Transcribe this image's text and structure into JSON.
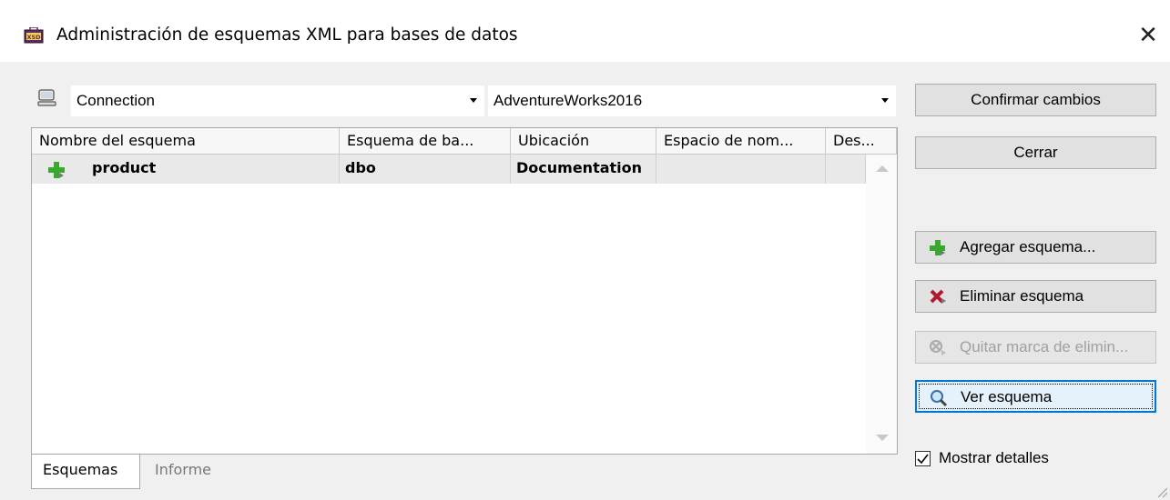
{
  "window": {
    "title": "Administración de esquemas XML para bases de datos",
    "close_glyph": "✕",
    "icon_text": "XSD"
  },
  "connection": {
    "type_value": "Connection",
    "database_value": "AdventureWorks2016"
  },
  "grid": {
    "columns": [
      "Nombre del esquema",
      "Esquema de ba...",
      "Ubicación",
      "Espacio de nom...",
      "Des..."
    ],
    "rows": [
      {
        "name": "product",
        "schema": "dbo",
        "location": "Documentation",
        "namespace": "",
        "description": ""
      }
    ]
  },
  "tabs": [
    "Esquemas",
    "Informe"
  ],
  "buttons": {
    "commit": "Confirmar cambios",
    "close": "Cerrar",
    "add": "Agregar esquema...",
    "delete": "Eliminar esquema",
    "unmark": "Quitar marca de elimin...",
    "view": "Ver esquema"
  },
  "show_details": {
    "label": "Mostrar detalles",
    "checked": true
  },
  "colors": {
    "accent": "#0078d7",
    "add_green": "#3aa82f",
    "delete_red": "#b2182b"
  }
}
